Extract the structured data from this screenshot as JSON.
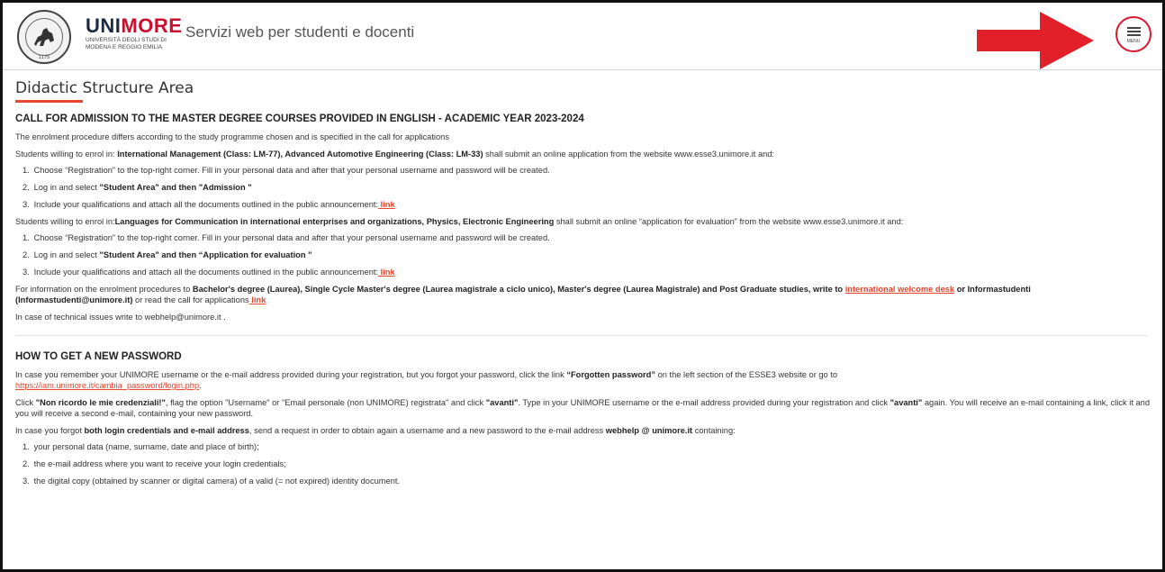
{
  "header": {
    "logo_name_prefix": "UNI",
    "logo_name_accent": "MORE",
    "logo_sub_1": "UNIVERSITÀ DEGLI STUDI DI",
    "logo_sub_2": "MODENA E REGGIO EMILIA",
    "seal_year": "1175",
    "site_title": "Servizi web per studenti e docenti",
    "menu_label": "MENU",
    "colors": {
      "brand_red": "#c8102e",
      "brand_navy": "#1d2a44",
      "arrow_red": "#e2202a",
      "link": "#e8452c"
    }
  },
  "page": {
    "title": "Didactic Structure Area"
  },
  "section1": {
    "heading": "CALL FOR ADMISSION TO THE MASTER DEGREE COURSES PROVIDED IN ENGLISH - ACADEMIC YEAR 2023-2024",
    "intro": "The enrolment procedure differs according to the study programme chosen and is specified in the call for applications",
    "p1_lead": "Students willing to enrol in: ",
    "p1_bold": "International Management (Class: LM-77), Advanced Automotive Engineering (Class: LM-33)",
    "p1_tail": " shall submit an online application from the website www.esse3.unimore.it and:",
    "list1": {
      "i1": "Choose “Registration” to the top-right corner. Fill in your personal data and after that your personal username and password will be created.",
      "i2_lead": "Log in and select ",
      "i2_bold": "\"Student Area\" and then \"Admission \"",
      "i3_lead": "Include your qualifications and attach all the documents outlined in the public announcement:",
      "i3_link": " link"
    },
    "p2_lead": "Students willing to enrol in:",
    "p2_bold": "Languages for Communication in international enterprises and organizations, Physics, Electronic Engineering",
    "p2_tail": " shall submit an online “application for evaluation” from the website www.esse3.unimore.it and:",
    "list2": {
      "i1": "Choose “Registration” to the top-right corner. Fill in your personal data and after that your personal username and password will be created.",
      "i2_lead": "Log in and select ",
      "i2_bold": "\"Student Area\" and then “Application for evaluation \"",
      "i3_lead": "Include your qualifications and attach all the documents outlined in the public announcement:",
      "i3_link": " link"
    },
    "p3_lead": "For information on the enrolment procedures to ",
    "p3_bold": "Bachelor's degree (Laurea), Single Cycle Master's degree (Laurea magistrale a ciclo unico), Master's degree (Laurea Magistrale) and Post Graduate studies, write to ",
    "p3_link": "international welcome desk",
    "p3_bold2": " or Informastudenti (Informastudenti@unimore.it)",
    "p3_tail": " or read the call for applications",
    "p3_link2": " link",
    "p4": "In case of technical issues write to webhelp@unimore.it ."
  },
  "section2": {
    "heading": "HOW TO GET A NEW PASSWORD",
    "p1_lead": "In case you remember your UNIMORE username or the e-mail address provided during your registration, but you forgot your password, click the link ",
    "p1_bold": "“Forgotten password”",
    "p1_tail": " on the left section of the ESSE3 website or go to",
    "p1_link": "https://iam.unimore.it/cambia_password/login.php",
    "p1_end": ".",
    "p2_lead": "Click ",
    "p2_bold1": "\"Non ricordo le mie credenziali!\"",
    "p2_mid1": ", flag the option \"Username\" or \"Email personale (non UNIMORE) registrata\" and click ",
    "p2_bold2": "\"avanti\"",
    "p2_mid2": ". Type in your UNIMORE username or the e-mail address provided during your registration and click ",
    "p2_bold3": "\"avanti\"",
    "p2_tail": " again. You will receive an e-mail containing a link, click it and you will receive a second e-mail, containing your new password.",
    "p3_lead": "In case you forgot ",
    "p3_bold": "both login credentials and e-mail address",
    "p3_mid": ", send a request in order to obtain again a username and a new password to the e-mail address ",
    "p3_bold2": "webhelp @ unimore.it",
    "p3_tail": " containing:",
    "list": {
      "i1": "your personal data (name, surname, date and place of birth);",
      "i2": "the e-mail address where you want to receive your login credentials;",
      "i3": "the digital copy (obtained by scanner or digital camera) of a valid (= not expired) identity document."
    }
  },
  "list_numbers": [
    "1.",
    "2.",
    "3."
  ]
}
